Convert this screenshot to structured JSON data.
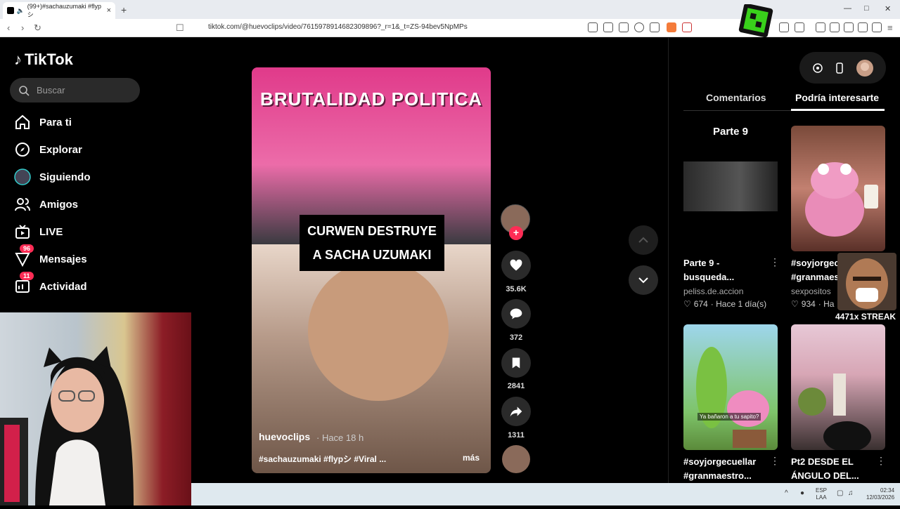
{
  "browser": {
    "tab_title": "(99+)#sachauzumaki #flypシ",
    "tab_close": "×",
    "new_tab": "+",
    "url": "tiktok.com/@huevoclips/video/7615978914682309896?_r=1&_t=ZS-94bev5NpMPs",
    "window_min": "—",
    "window_max": "□",
    "window_close": "✕"
  },
  "sidebar": {
    "logo": "TikTok",
    "search_placeholder": "Buscar",
    "items": [
      {
        "label": "Para ti",
        "icon": "home-icon"
      },
      {
        "label": "Explorar",
        "icon": "compass-icon"
      },
      {
        "label": "Siguiendo",
        "icon": "following-avatar"
      },
      {
        "label": "Amigos",
        "icon": "friends-icon"
      },
      {
        "label": "LIVE",
        "icon": "live-icon"
      },
      {
        "label": "Mensajes",
        "icon": "messages-icon",
        "badge": "96"
      },
      {
        "label": "Actividad",
        "icon": "activity-icon",
        "badge": "11"
      }
    ]
  },
  "video": {
    "banner_text": "BRUTALIDAD POLITICA",
    "caption_line1": "CURWEN DESTRUYE",
    "caption_line2": "A SACHA UZUMAKI",
    "author": "huevoclips",
    "time": "· Hace 18 h",
    "tags": "#sachauzumaki #flypシ #Viral ...",
    "more": "más"
  },
  "actions": {
    "likes": "35.6K",
    "comments": "372",
    "saves": "2841",
    "shares": "1311"
  },
  "right_panel": {
    "tab_comments": "Comentarios",
    "tab_related": "Podría interesarte",
    "cards": [
      {
        "cover_text": "Parte 9",
        "title1": "Parte 9 -",
        "title2": "busqueda...",
        "author": "peliss.de.accion",
        "likes": "674",
        "time": "· Hace 1 día(s)"
      },
      {
        "title1": "#soyjorgec",
        "title2": "#granmaes",
        "author": "sexpositos",
        "likes": "934",
        "time": "· Ha"
      },
      {
        "overlay": "Ya bañaron a tu sapito?",
        "title1": "#soyjorgecuellar",
        "title2": "#granmaestro..."
      },
      {
        "title1": "Pt2 DESDE EL",
        "title2": "ÁNGULO DEL..."
      }
    ]
  },
  "overlay": {
    "streak": "4471x STREAK"
  },
  "taskbar": {
    "lang1": "ESP",
    "lang2": "LAA",
    "time": "02:34",
    "date": "12/03/2026"
  },
  "colors": {
    "accent": "#fe2c55",
    "background": "#000000"
  }
}
